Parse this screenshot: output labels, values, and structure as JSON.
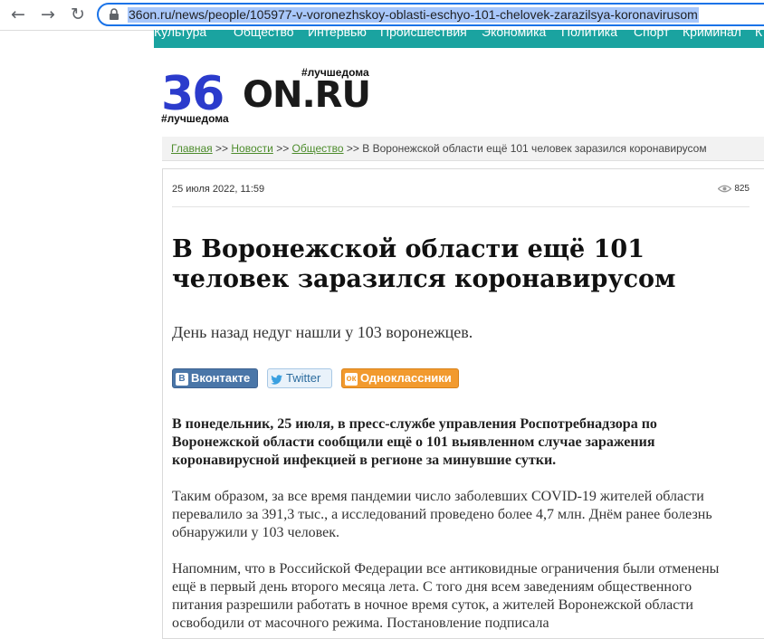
{
  "browser": {
    "url": "36on.ru/news/people/105977-v-voronezhskoy-oblasti-eschyo-101-chelovek-zarazilsya-koronavirusom",
    "back_glyph": "←",
    "forward_glyph": "→",
    "reload_glyph": "↻"
  },
  "menu": {
    "items": [
      "Культура",
      "Общество",
      "Интервью",
      "Происшествия",
      "Экономика",
      "Политика",
      "Спорт",
      "Криминал",
      "К"
    ]
  },
  "logo": {
    "number": "36",
    "domain": "ON.RU",
    "tag_top": "#лучшедома",
    "tag_bottom": "#лучшедома"
  },
  "breadcrumb": {
    "home": "Главная",
    "news": "Новости",
    "society": "Общество",
    "sep": ">>",
    "current": "В Воронежской области ещё 101 человек заразился коронавирусом"
  },
  "article": {
    "date": "25 июля 2022, 11:59",
    "views": "825",
    "title": "В Воронежской области ещё 101 человек заразился коронавирусом",
    "lead": "День назад недуг нашли у 103 воронежцев.",
    "share": {
      "vk": "Вконтакте",
      "twitter": "Twitter",
      "ok": "Одноклассники"
    },
    "paragraphs": [
      "В понедельник, 25 июля, в пресс-службе управления Роспотребнадзора по Воронежской области сообщили ещё о 101 выявленном случае заражения коронавирусной инфекцией в регионе за минувшие сутки.",
      "Таким образом, за все время пандемии число заболевших COVID-19 жителей области перевалило за 391,3 тыс., а исследований проведено более 4,7 млн. Днём ранее болезнь обнаружили у 103 человек.",
      "Напомним, что в Российской Федерации все антиковидные ограничения были отменены ещё в первый день второго месяца лета. С того дня всем заведениям общественного питания разрешили работать в ночное время суток, а жителей Воронежской области освободили от масочного режима. Постановление подписала"
    ]
  },
  "colors": {
    "menu_bg": "#1aa3a0",
    "logo_blue": "#2b3bcc",
    "link_green": "#4d8c2c",
    "url_focus": "#1a73e8"
  }
}
